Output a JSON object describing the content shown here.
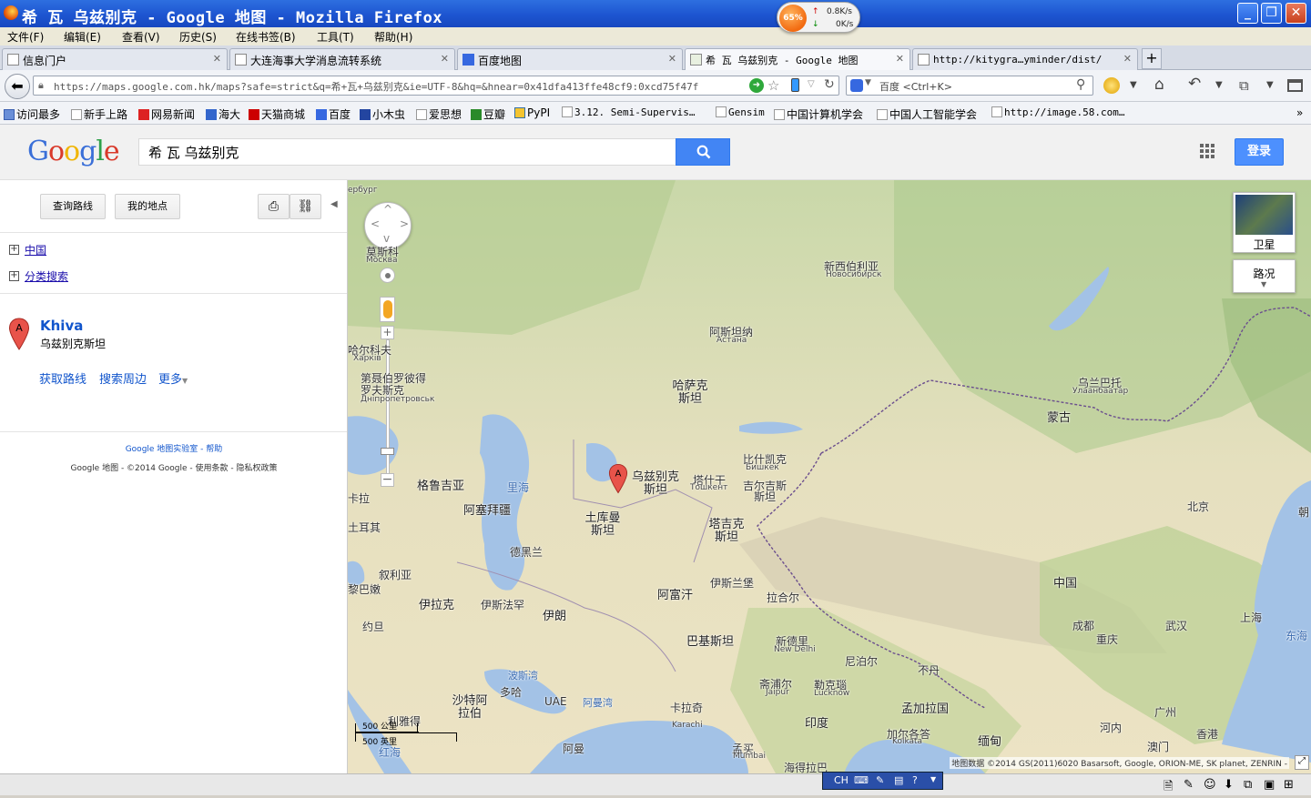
{
  "window": {
    "title": "希 瓦 乌兹别克 - Google 地图 - Mozilla Firefox",
    "netmon": {
      "percent": "65%",
      "up": "0.8K/s",
      "down": "0K/s"
    }
  },
  "menu": [
    "文件(F)",
    "编辑(E)",
    "查看(V)",
    "历史(S)",
    "在线书签(B)",
    "工具(T)",
    "帮助(H)"
  ],
  "tabs": [
    {
      "label": "信息门户"
    },
    {
      "label": "大连海事大学消息流转系统"
    },
    {
      "label": "百度地图"
    },
    {
      "label": "希 瓦 乌兹别克 - Google 地图",
      "active": true
    },
    {
      "label": "http://kitygra…yminder/dist/"
    }
  ],
  "nav": {
    "url": "https://maps.google.com.hk/maps?safe=strict&q=希+瓦+乌兹别克&ie=UTF-8&hq=&hnear=0x41dfa413ffe48cf9:0xcd75f47f",
    "search_placeholder": "百度 <Ctrl+K>"
  },
  "bookmarks": [
    "访问最多",
    "新手上路",
    "网易新闻",
    "海大",
    "天猫商城",
    "百度",
    "小木虫",
    "爱思想",
    "豆瓣",
    "PyPI",
    "3.12. Semi-Supervis…",
    "Gensim",
    "中国计算机学会",
    "中国人工智能学会",
    "http://image.58.com…"
  ],
  "google": {
    "logo": "Google",
    "query": "希 瓦 乌兹别克",
    "login": "登录"
  },
  "sidebar": {
    "btn_directions": "查询路线",
    "btn_myplaces": "我的地点",
    "link_china": "中国",
    "link_category": "分类搜索",
    "marker": "A",
    "result_title": "Khiva",
    "result_sub": "乌兹别克斯坦",
    "act_directions": "获取路线",
    "act_nearby": "搜索周边",
    "act_more": "更多",
    "footer1": "Google 地图实验室 - 帮助",
    "footer2": "Google 地图 - ©2014 Google - 使用条款 - 隐私权政策"
  },
  "map": {
    "sat_label": "卫星",
    "road_label": "路况",
    "scale1": "500 公里",
    "scale2": "500 英里",
    "copyright": "地图数据 ©2014 GS(2011)6020 Basarsoft, Google, ORION-ME, SK planet, ZENRIN -",
    "labels": {
      "moscow": "莫斯科",
      "moscow_en": "Москва",
      "novosibirsk": "新西伯利亚",
      "novosibirsk_en": "Новосибирск",
      "astana": "阿斯坦纳",
      "astana_en": "Астана",
      "kharkiv": "哈尔科夫",
      "kharkiv_en": "Харків",
      "dnipro": "第聂伯罗彼得罗夫斯克",
      "dnipro_en": "Дніпропетровськ",
      "kazakhstan": "哈萨克斯坦",
      "ulaanbaatar": "乌兰巴托",
      "ulaanbaatar_en": "Улаанбаатар",
      "mongolia": "蒙古",
      "bishkek": "比什凯克",
      "bishkek_en": "Бишкек",
      "uzbekistan": "乌兹别克斯坦",
      "tashkent": "塔什干",
      "tashkent_en": "Тошкент",
      "kyrgyzstan": "吉尔吉斯斯坦",
      "georgia": "格鲁吉亚",
      "caspian": "里海",
      "azerbaijan": "阿塞拜疆",
      "turkmenistan": "土库曼斯坦",
      "tajikistan": "塔吉克斯坦",
      "beijing": "北京",
      "korea": "朝",
      "tehran": "德黑兰",
      "syria": "叙利亚",
      "lebanon": "黎巴嫩",
      "iraq": "伊拉克",
      "isfahan": "伊斯法罕",
      "iran": "伊朗",
      "afghanistan": "阿富汗",
      "islamabad": "伊斯兰堡",
      "lahore": "拉合尔",
      "pakistan": "巴基斯坦",
      "china": "中国",
      "chengdu": "成都",
      "chongqing": "重庆",
      "wuhan": "武汉",
      "shanghai": "上海",
      "eastsea": "东海",
      "jordan": "约旦",
      "gulf": "波斯湾",
      "doha": "多哈",
      "uae": "UAE",
      "oman_gulf": "阿曼湾",
      "karachi": "卡拉奇",
      "karachi_en": "Karachi",
      "newdelhi": "新德里",
      "newdelhi_en": "New Delhi",
      "nepal": "尼泊尔",
      "bhutan": "不丹",
      "jaipur": "斋浦尔",
      "jaipur_en": "Jaipur",
      "lucknow": "勒克瑙",
      "lucknow_en": "Lucknow",
      "bangladesh": "孟加拉国",
      "india": "印度",
      "kolkata": "加尔各答",
      "kolkata_en": "Kolkata",
      "myanmar": "缅甸",
      "hanoi": "河内",
      "guangzhou": "广州",
      "hongkong": "香港",
      "macau": "澳门",
      "saudi": "沙特阿拉伯",
      "riyadh": "利雅得",
      "oman": "阿曼",
      "mumbai": "孟买",
      "mumbai_en": "Mumbai",
      "hyderabad": "海得拉巴",
      "redsea": "红海",
      "turkey": "土耳其",
      "spb": "ербург",
      "cyprus": "卡拉"
    }
  },
  "status": {
    "ime": "CH"
  }
}
